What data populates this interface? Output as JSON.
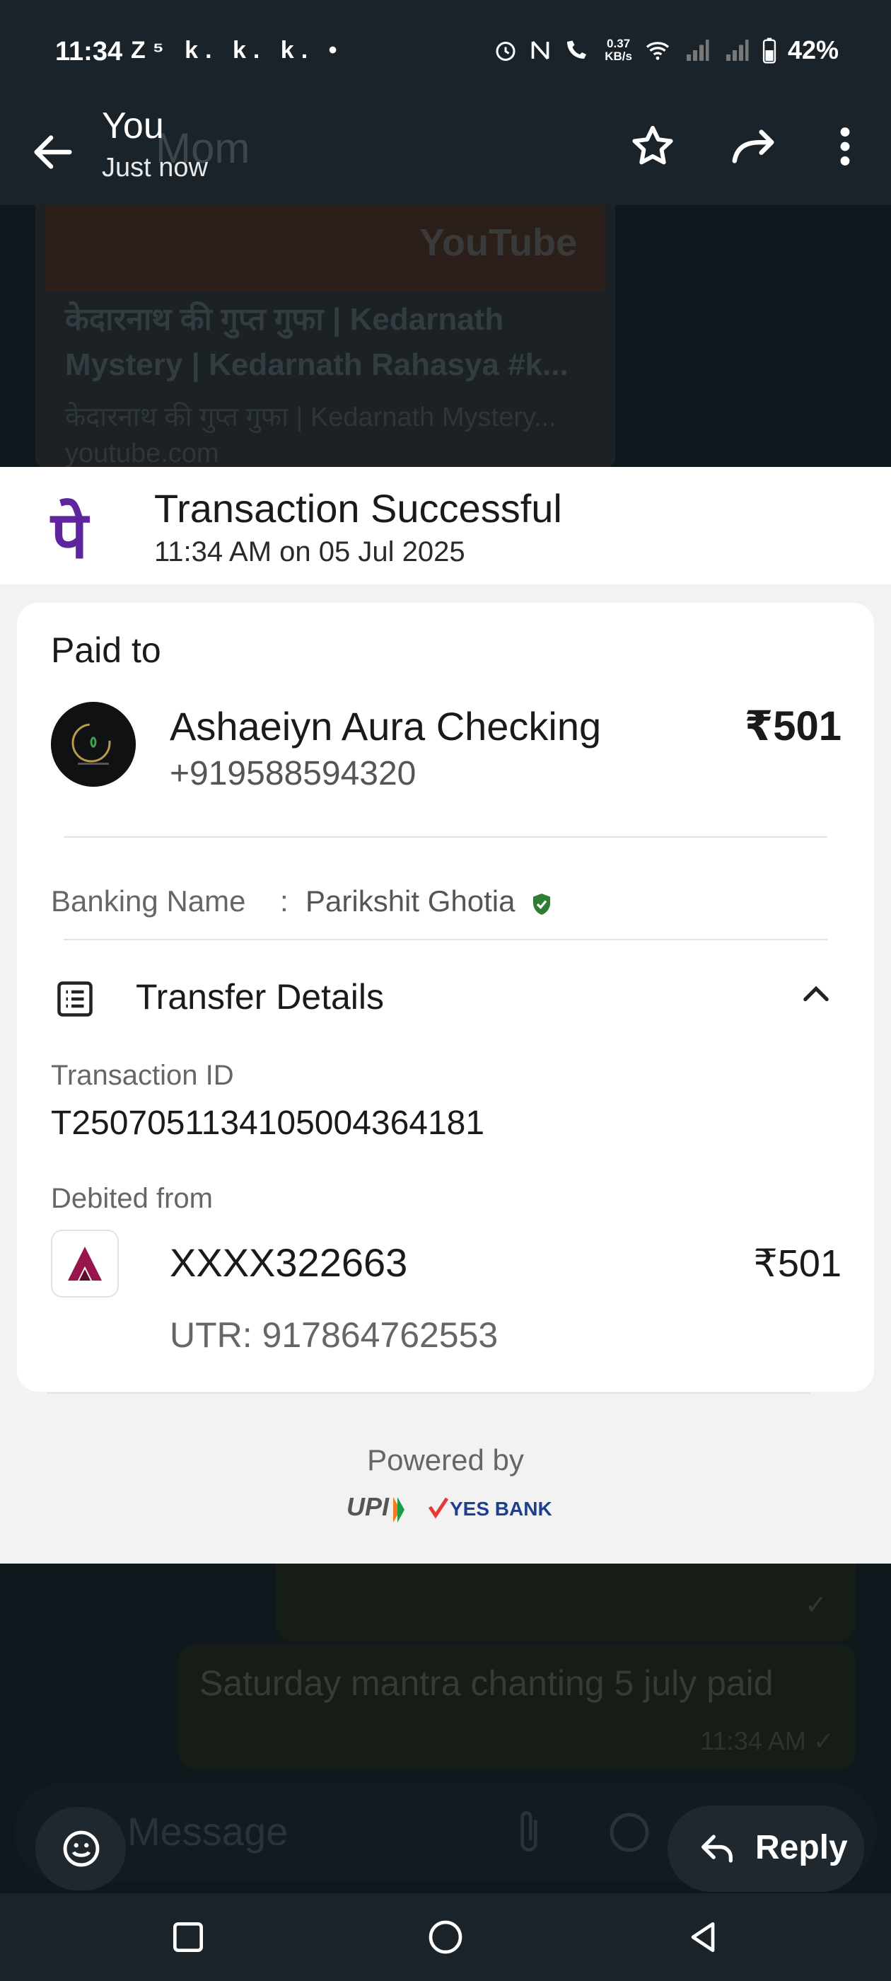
{
  "status_bar": {
    "time": "11:34",
    "left_icons": "Z⁵ k. k. k. •",
    "speed_top": "0.37",
    "speed_bottom": "KB/s",
    "battery": "42%"
  },
  "app_bar": {
    "title": "You",
    "subtitle": "Just now",
    "background_chat_name": "Mom"
  },
  "chat_background": {
    "youtube_logo": "YouTube",
    "video_title": "केदारनाथ की गुप्त गुफा | Kedarnath Mystery | Kedarnath Rahasya #k...",
    "video_desc": "केदारनाथ की गुप्त गुफा | Kedarnath Mystery...",
    "video_site": "youtube.com",
    "message_text": "Saturday mantra chanting 5 july paid",
    "message_time": "11:34 AM ✓",
    "tick": "✓",
    "input_placeholder": "Message"
  },
  "transaction": {
    "logo_glyph": "पे",
    "status": "Transaction Successful",
    "datetime": "11:34 AM on 05 Jul 2025",
    "paid_to_label": "Paid to",
    "payee_name": "Ashaeiyn Aura Checking",
    "payee_phone": "+919588594320",
    "amount": "₹501",
    "banking_name_label": "Banking Name",
    "banking_name_colon": ":",
    "banking_name_value": "Parikshit Ghotia",
    "transfer_details_label": "Transfer Details",
    "transaction_id_label": "Transaction ID",
    "transaction_id": "T2507051134105004364181",
    "debited_from_label": "Debited from",
    "account": "XXXX322663",
    "debit_amount": "₹501",
    "utr": "UTR: 917864762553",
    "powered_by": "Powered by",
    "upi_label": "UPI",
    "bank_label": "YES BANK"
  },
  "actions": {
    "reply_label": "Reply"
  },
  "colors": {
    "phonepe_purple": "#5f259f",
    "verified_green": "#2e7d32",
    "axis_red": "#97144d"
  }
}
